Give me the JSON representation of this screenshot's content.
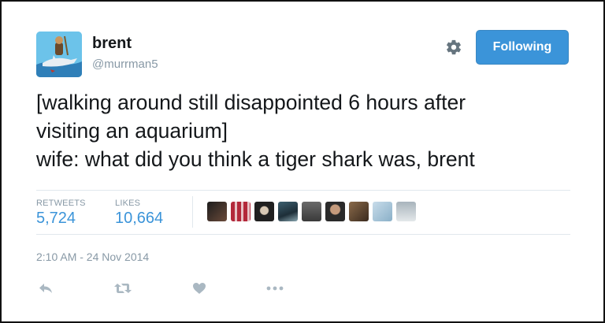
{
  "author": {
    "name": "brent",
    "handle": "@murrman5"
  },
  "follow_button": {
    "label": "Following"
  },
  "tweet": {
    "lines": [
      "[walking around still disappointed 6 hours after",
      "visiting an aquarium]",
      "wife: what did you think a tiger shark was, brent"
    ]
  },
  "stats": {
    "retweets_label": "RETWEETS",
    "retweets_value": "5,724",
    "likes_label": "LIKES",
    "likes_value": "10,664"
  },
  "timestamp": "2:10 AM - 24 Nov 2014",
  "actions": [
    "reply-icon",
    "retweet-icon",
    "like-icon",
    "more-icon"
  ],
  "colors": {
    "accent": "#3b94d9",
    "muted": "#8899a6",
    "text": "#14171a"
  }
}
